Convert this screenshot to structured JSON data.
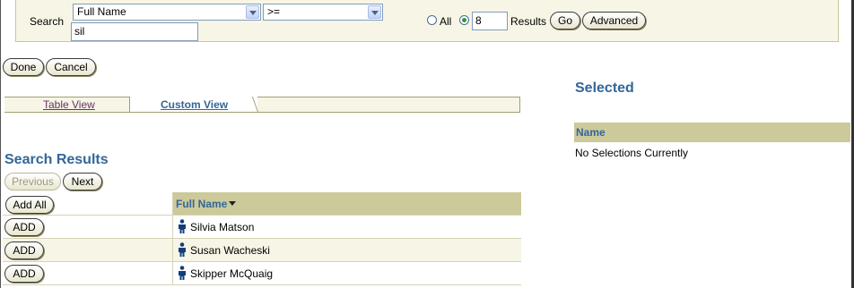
{
  "search": {
    "label": "Search",
    "field_selected": "Full Name",
    "operator_selected": ">=",
    "query_value": "sil",
    "all_label": "All",
    "count_value": "8",
    "results_label": "Results",
    "go_label": "Go",
    "advanced_label": "Advanced"
  },
  "actions": {
    "done_label": "Done",
    "cancel_label": "Cancel"
  },
  "tabs": [
    {
      "label": "Table View",
      "active": false
    },
    {
      "label": "Custom View",
      "active": true
    }
  ],
  "results": {
    "title": "Search Results",
    "previous_label": "Previous",
    "next_label": "Next",
    "add_all_label": "Add All",
    "column_header": "Full Name",
    "rows": [
      {
        "button": "ADD",
        "name": "Silvia Matson"
      },
      {
        "button": "ADD",
        "name": "Susan Wacheski"
      },
      {
        "button": "ADD",
        "name": "Skipper McQuaig"
      }
    ]
  },
  "selected": {
    "title": "Selected",
    "column_header": "Name",
    "empty_text": "No Selections Currently"
  },
  "colors": {
    "accent": "#336699",
    "header_bg": "#ccc99a",
    "panel_bg": "#f7f5e6"
  },
  "icons": {
    "person": "person-icon",
    "sort": "sort-descending-icon",
    "dropdown": "chevron-down-icon"
  }
}
